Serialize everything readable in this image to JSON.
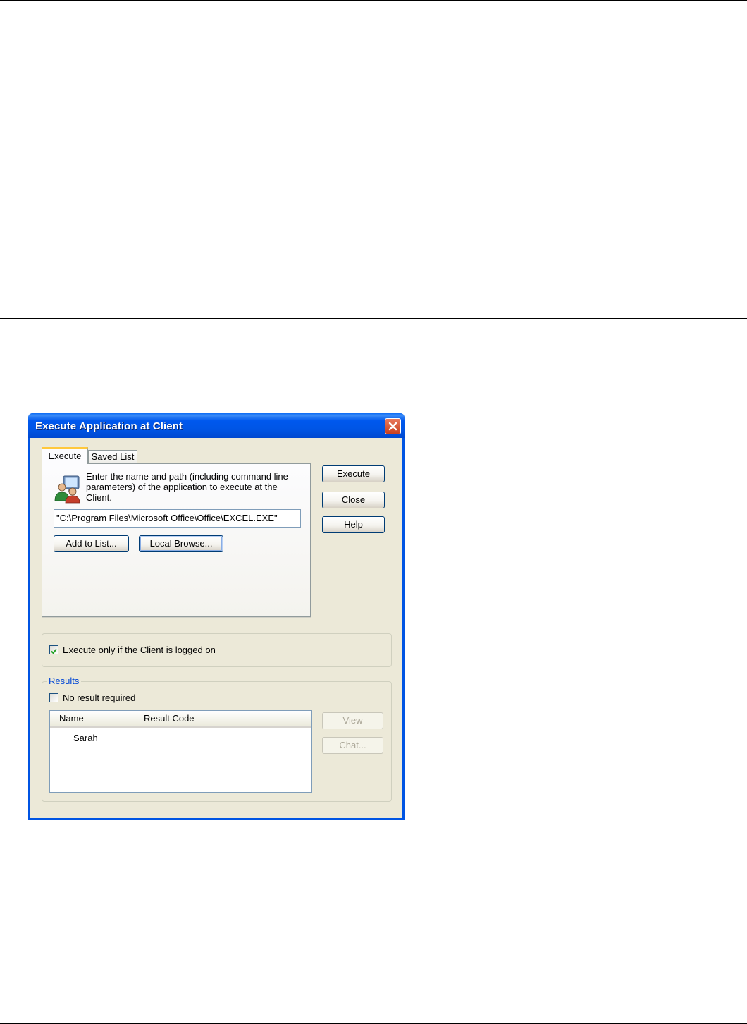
{
  "dialog": {
    "title": "Execute Application at Client",
    "close_icon": "close-x-icon",
    "tabs": [
      {
        "label": "Execute",
        "active": true
      },
      {
        "label": "Saved List",
        "active": false
      }
    ],
    "instruction": "Enter the name and path (including command line parameters) of the application to execute at the Client.",
    "app_icon": "users-computer-icon",
    "path_value": "\"C:\\Program Files\\Microsoft Office\\Office\\EXCEL.EXE\"",
    "add_to_list_label": "Add to List...",
    "local_browse_label": "Local Browse...",
    "side_buttons": {
      "execute_label": "Execute",
      "close_label": "Close",
      "help_label": "Help"
    },
    "logged_on_option": {
      "label": "Execute only if the Client is logged on",
      "checked": true
    },
    "results": {
      "group_label": "Results",
      "no_result": {
        "label": "No result required",
        "checked": false
      },
      "columns": [
        "Name",
        "Result Code"
      ],
      "rows": [
        {
          "name": "Sarah",
          "result_code": ""
        }
      ],
      "view_label": "View",
      "chat_label": "Chat..."
    }
  }
}
